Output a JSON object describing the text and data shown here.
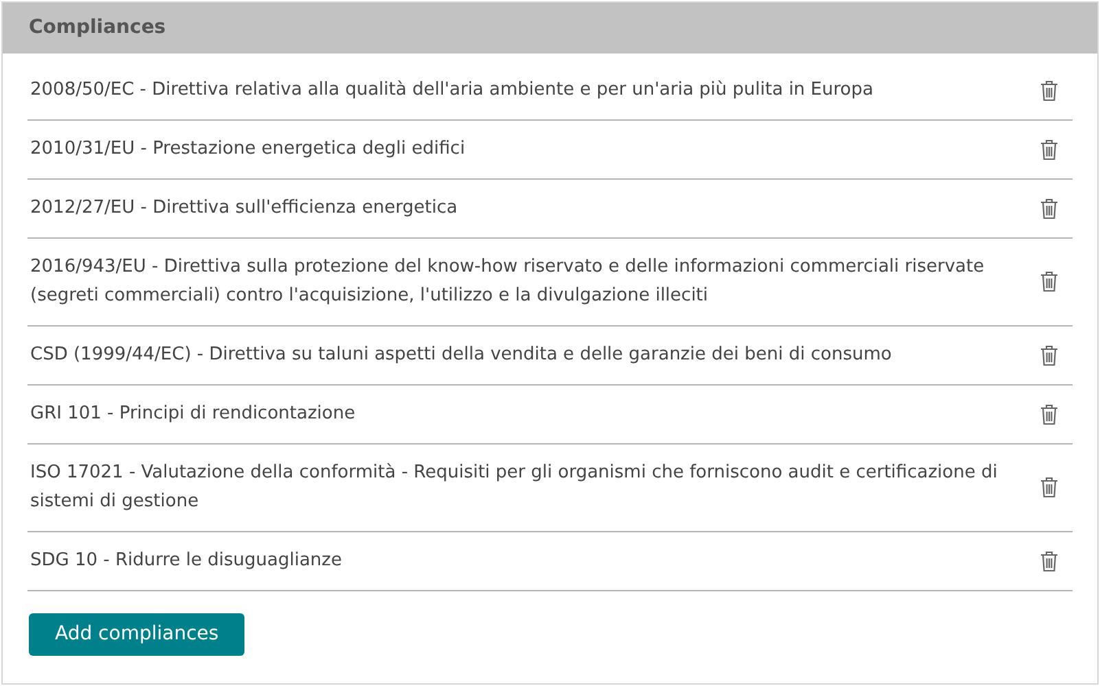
{
  "panel": {
    "title": "Compliances"
  },
  "items": [
    {
      "text": "2008/50/EC - Direttiva relativa alla qualità dell'aria ambiente e per un'aria più pulita in Europa"
    },
    {
      "text": "2010/31/EU - Prestazione energetica degli edifici"
    },
    {
      "text": "2012/27/EU - Direttiva sull'efficienza energetica"
    },
    {
      "text": "2016/943/EU - Direttiva sulla protezione del know-how riservato e delle informazioni commerciali riservate (segreti commerciali) contro l'acquisizione, l'utilizzo e la divulgazione illeciti"
    },
    {
      "text": "CSD (1999/44/EC) - Direttiva su taluni aspetti della vendita e delle garanzie dei beni di consumo"
    },
    {
      "text": "GRI 101 - Principi di rendicontazione"
    },
    {
      "text": "ISO 17021 - Valutazione della conformità - Requisiti per gli organismi che forniscono audit e certificazione di sistemi di gestione"
    },
    {
      "text": "SDG 10 - Ridurre le disuguaglianze"
    }
  ],
  "add_button": "Add compliances"
}
